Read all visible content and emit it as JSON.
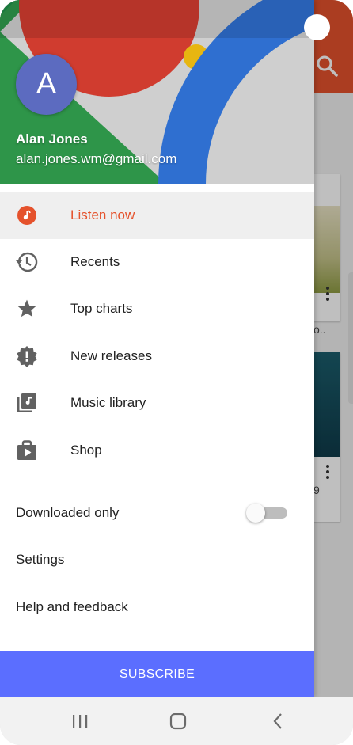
{
  "header": {
    "avatar_letter": "A",
    "user_name": "Alan Jones",
    "user_email": "alan.jones.wm@gmail.com"
  },
  "nav": {
    "items": [
      {
        "label": "Listen now",
        "icon": "listen-now-icon",
        "active": true
      },
      {
        "label": "Recents",
        "icon": "history-icon",
        "active": false
      },
      {
        "label": "Top charts",
        "icon": "star-icon",
        "active": false
      },
      {
        "label": "New releases",
        "icon": "new-releases-badge-icon",
        "active": false
      },
      {
        "label": "Music library",
        "icon": "music-library-icon",
        "active": false
      },
      {
        "label": "Shop",
        "icon": "shop-bag-icon",
        "active": false
      }
    ]
  },
  "settings_section": {
    "downloaded_only_label": "Downloaded only",
    "downloaded_only_enabled": false,
    "settings_label": "Settings",
    "help_label": "Help and feedback"
  },
  "subscribe_label": "SUBSCRIBE",
  "background_app": {
    "card_snippet_1": "o..",
    "card_snippet_2": "9"
  },
  "colors": {
    "accent": "#e5522c",
    "subscribe": "#5b6eff",
    "avatar": "#5c6bc0"
  },
  "system_nav": {
    "buttons": [
      "recent-apps-icon",
      "home-icon",
      "back-icon"
    ]
  }
}
